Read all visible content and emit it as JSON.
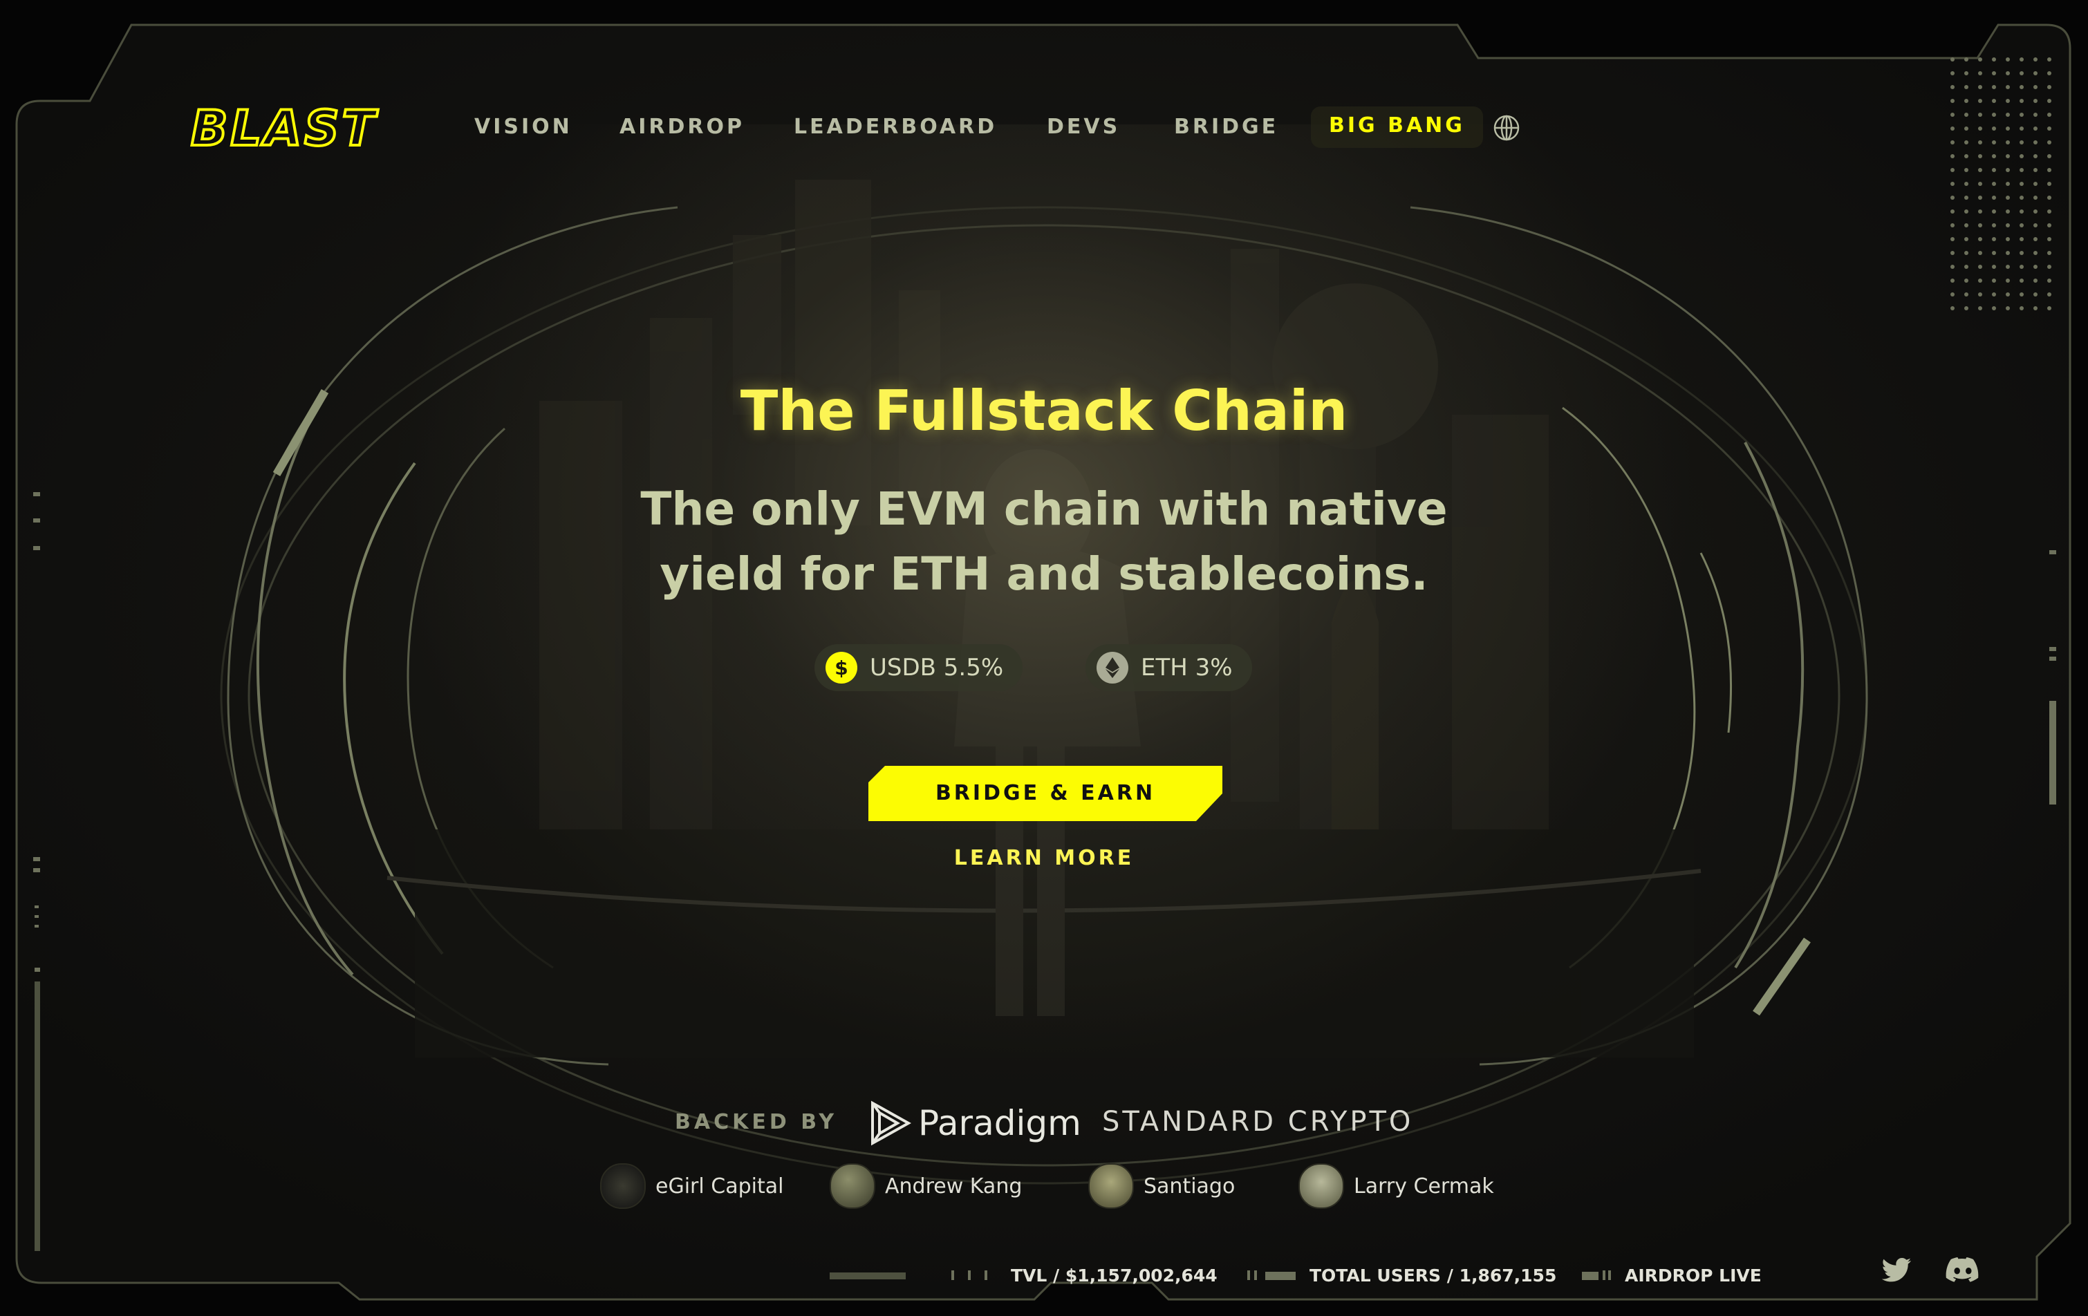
{
  "brand": {
    "logo_text": "BLAST"
  },
  "nav": {
    "items": [
      {
        "label": "VISION"
      },
      {
        "label": "AIRDROP"
      },
      {
        "label": "LEADERBOARD"
      },
      {
        "label": "DEVS"
      },
      {
        "label": "BRIDGE"
      },
      {
        "label": "BIG BANG",
        "active": true
      }
    ],
    "language_icon": "globe-icon"
  },
  "hero": {
    "title": "The Fullstack Chain",
    "subtitle_line1": "The only EVM chain with native",
    "subtitle_line2": "yield for ETH and stablecoins.",
    "yields": [
      {
        "label": "USDB 5.5%",
        "icon": "dollar-coin-icon"
      },
      {
        "label": "ETH 3%",
        "icon": "ethereum-icon"
      }
    ],
    "primary_cta": "BRIDGE & EARN",
    "secondary_cta": "LEARN MORE"
  },
  "backers": {
    "label": "BACKED BY",
    "primary": [
      "Paradigm",
      "STANDARD CRYPTO"
    ],
    "angels": [
      "eGirl Capital",
      "Andrew Kang",
      "Santiago",
      "Larry Cermak"
    ]
  },
  "stats": {
    "tvl": "TVL / $1,157,002,644",
    "users": "TOTAL USERS / 1,867,155",
    "airdrop": "AIRDROP LIVE"
  },
  "social": [
    "twitter-icon",
    "discord-icon"
  ],
  "colors": {
    "accent": "#fcfc03",
    "title": "#fcf454",
    "text": "#c9cfa6",
    "frame": "#8b9272",
    "background": "#050505"
  }
}
